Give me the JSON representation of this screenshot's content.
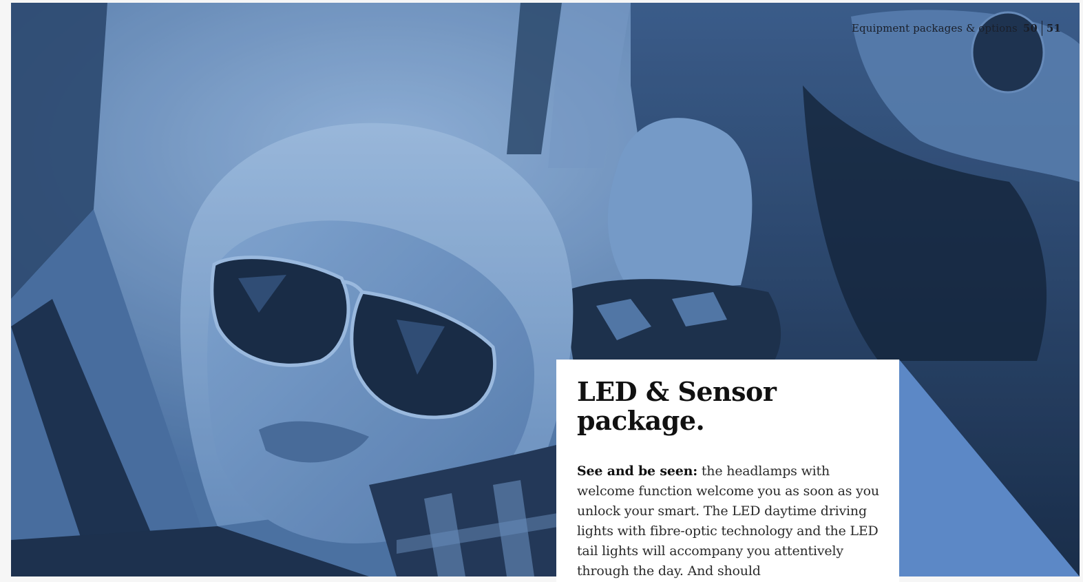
{
  "header": {
    "section_label": "Equipment packages & options",
    "page_left": "50",
    "page_right": "51"
  },
  "article": {
    "title": "LED & Sensor package.",
    "lead": "See and be seen:",
    "body": " the headlamps with welcome function welcome you as soon as you unlock your smart. The LED daytime driving lights with fibre-optic technology and the LED tail lights will accompany you attentively through the day. And should"
  },
  "colors": {
    "duotone_light": "#8fb0d6",
    "duotone_mid": "#5b7fae",
    "duotone_dark": "#142338",
    "accent_blue": "#5c88c6",
    "card_background": "#ffffff"
  },
  "image": {
    "description_icon": "photo-duotone-couple"
  }
}
